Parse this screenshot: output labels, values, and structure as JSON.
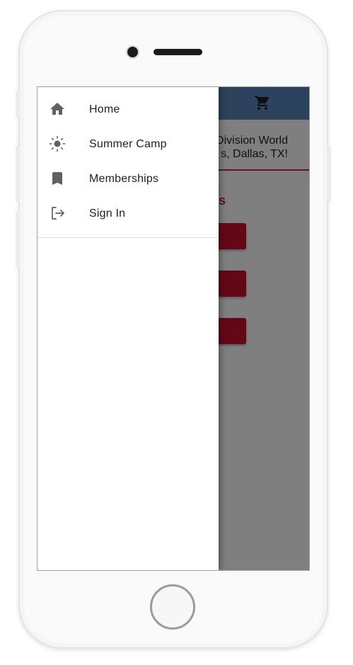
{
  "drawer": {
    "items": [
      {
        "label": "Home",
        "icon": "home-icon"
      },
      {
        "label": "Summer Camp",
        "icon": "sun-icon"
      },
      {
        "label": "Memberships",
        "icon": "bookmark-icon"
      },
      {
        "label": "Sign In",
        "icon": "sign-in-icon"
      }
    ]
  },
  "background_page": {
    "hero_line_1": "Division World",
    "hero_line_2": "s, Dallas, TX!",
    "section_heading_fragment": "s"
  },
  "colors": {
    "appbar": "#5b85b8",
    "accent_red": "#c8102e",
    "scrim": "rgba(0,0,0,0.5)"
  }
}
